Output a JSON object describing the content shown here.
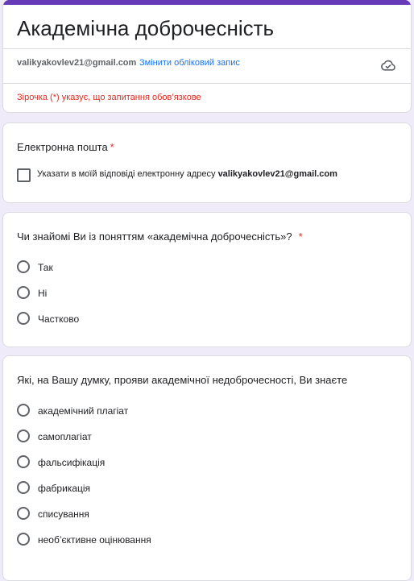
{
  "form": {
    "title": "Академічна доброчесність",
    "account_email": "valikyakovlev21@gmail.com",
    "switch_account": "Змінити обліковий запис",
    "required_note": "Зірочка (*) указує, що запитання обов’язкове",
    "accent_color": "#673ab7"
  },
  "email_question": {
    "title": "Електронна пошта",
    "asterisk": "*",
    "checkbox_text": "Указати в моїй відповіді електронну адресу",
    "checkbox_email": "valikyakovlev21@gmail.com"
  },
  "question1": {
    "title": "Чи знайомі Ви із поняттям «академічна доброчесність»?",
    "asterisk": "*",
    "options": [
      "Так",
      "Ні",
      "Частково"
    ]
  },
  "question2": {
    "title": "Які, на Вашу думку, прояви академічної недоброчесності, Ви знаєте",
    "options": [
      "академічний плагіат",
      "самоплагіат",
      "фальсифікація",
      "фабрикація",
      "списування",
      "необ’єктивне оцінювання"
    ]
  },
  "icons": {
    "cloud_status": "cloud-saved-icon"
  }
}
